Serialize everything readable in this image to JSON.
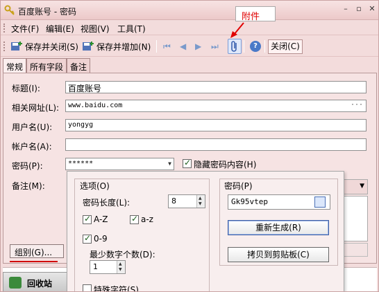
{
  "window": {
    "title": "百度账号 - 密码"
  },
  "annotation": {
    "label": "附件"
  },
  "menu": [
    "文件(F)",
    "编辑(E)",
    "视图(V)",
    "工具(T)"
  ],
  "toolbar": {
    "save_close": "保存并关闭(S)",
    "save_add": "保存并增加(N)",
    "help": "?",
    "close": "关闭(C)"
  },
  "tabs": [
    "常规",
    "所有字段",
    "备注"
  ],
  "form": {
    "title_label": "标题(I):",
    "title_value": "百度账号",
    "url_label": "相关网址(L):",
    "url_value": "www.baidu.com",
    "url_more": "···",
    "username_label": "用户名(U):",
    "username_value": "yongyg",
    "account_label": "帐户名(A):",
    "account_value": "",
    "password_label": "密码(P):",
    "password_value": "******",
    "hide_password_label": "隐藏密码内容(H)",
    "notes_label": "备注(M):",
    "group_button": "组别(G)..."
  },
  "generator": {
    "options_label": "选项(O)",
    "length_label": "密码长度(L):",
    "length_value": "8",
    "az_label": "A-Z",
    "az_lower_label": "a-z",
    "digits_label": "0-9",
    "min_digits_label": "最少数字个数(D):",
    "min_digits_value": "1",
    "special_label": "特殊字符(S)",
    "password_label": "密码(P)",
    "password_value": "Gk95vtep",
    "regenerate": "重新生成(R)",
    "copy": "拷贝到剪贴板(C)"
  },
  "sidebar": {
    "recycle": "回收站"
  }
}
